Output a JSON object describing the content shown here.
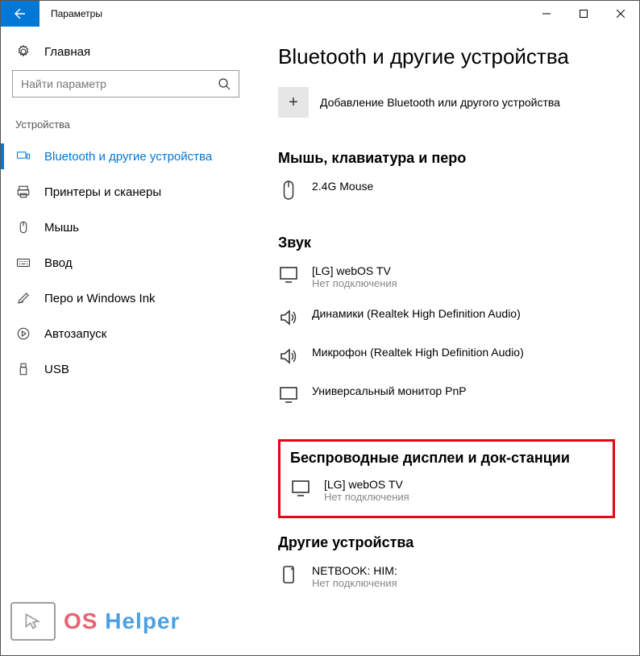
{
  "window": {
    "title": "Параметры"
  },
  "sidebar": {
    "home_label": "Главная",
    "search_placeholder": "Найти параметр",
    "category_label": "Устройства",
    "items": [
      {
        "label": "Bluetooth и другие устройства"
      },
      {
        "label": "Принтеры и сканеры"
      },
      {
        "label": "Мышь"
      },
      {
        "label": "Ввод"
      },
      {
        "label": "Перо и Windows Ink"
      },
      {
        "label": "Автозапуск"
      },
      {
        "label": "USB"
      }
    ]
  },
  "main": {
    "title": "Bluetooth и другие устройства",
    "add_label": "Добавление Bluetooth или другого устройства",
    "sections": {
      "mouse_kb": {
        "header": "Мышь, клавиатура и перо",
        "items": [
          {
            "name": "2.4G Mouse",
            "status": ""
          }
        ]
      },
      "audio": {
        "header": "Звук",
        "items": [
          {
            "name": "[LG] webOS TV",
            "status": "Нет подключения"
          },
          {
            "name": "Динамики (Realtek High Definition Audio)",
            "status": ""
          },
          {
            "name": "Микрофон (Realtek High Definition Audio)",
            "status": ""
          },
          {
            "name": "Универсальный монитор PnP",
            "status": ""
          }
        ]
      },
      "wireless": {
        "header": "Беспроводные дисплеи и док-станции",
        "items": [
          {
            "name": "[LG] webOS TV",
            "status": "Нет подключения"
          }
        ]
      },
      "other": {
        "header": "Другие устройства",
        "items": [
          {
            "name": "NETBOOK: HIM:",
            "status": "Нет подключения"
          }
        ]
      }
    }
  },
  "watermark": {
    "os": "OS",
    "helper": "Helper"
  }
}
